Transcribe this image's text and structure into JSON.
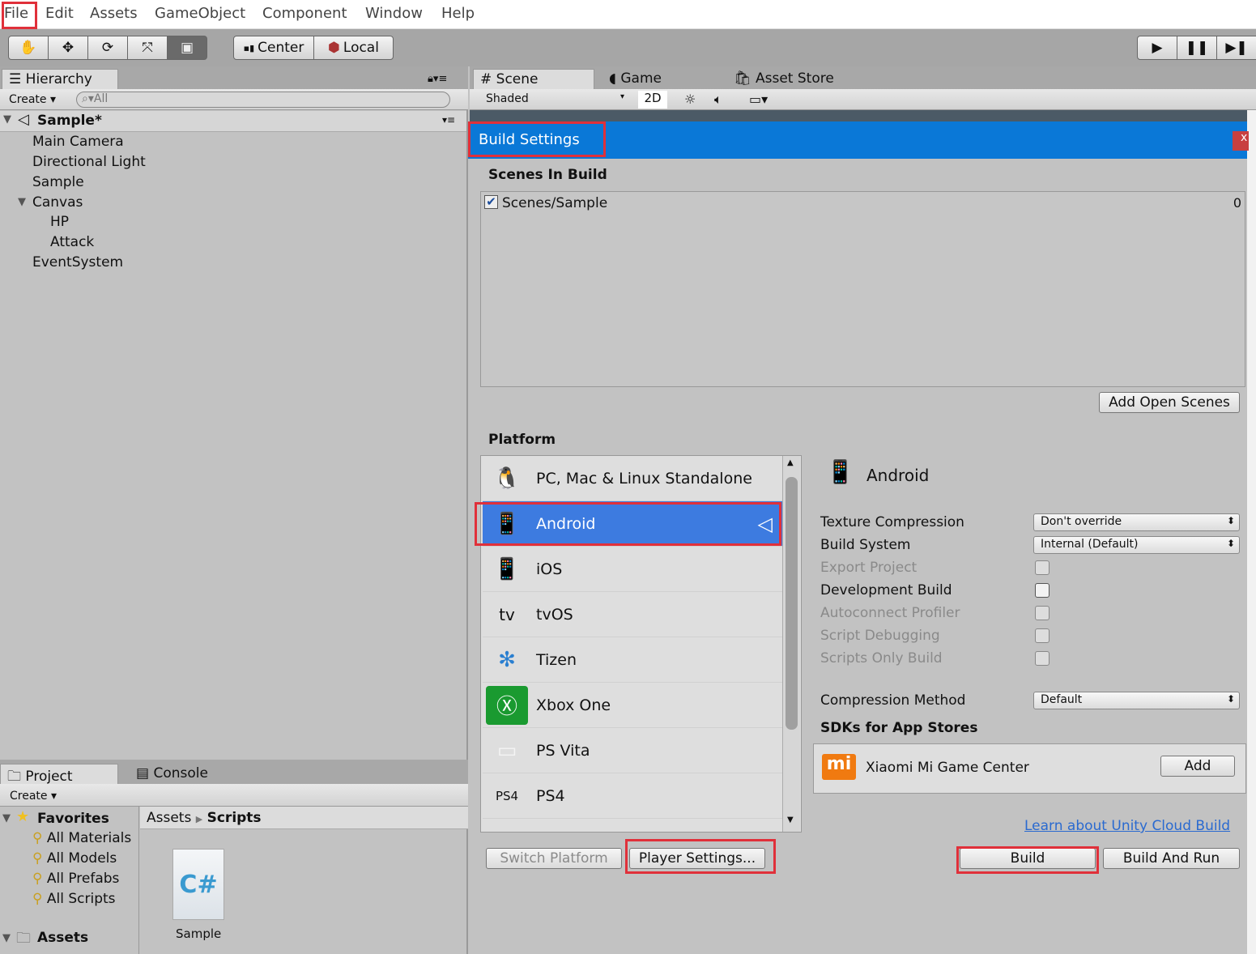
{
  "menu": [
    "File",
    "Edit",
    "Assets",
    "GameObject",
    "Component",
    "Window",
    "Help"
  ],
  "toolbar": {
    "tools": [
      "hand-tool",
      "move-tool",
      "rotate-tool",
      "scale-tool",
      "rect-tool"
    ],
    "pivot": "Center",
    "space": "Local"
  },
  "hierarchy": {
    "tab": "Hierarchy",
    "create": "Create",
    "search_placeholder": "All",
    "scene": "Sample*",
    "items": [
      "Main Camera",
      "Directional Light",
      "Sample",
      "Canvas",
      "HP",
      "Attack",
      "EventSystem"
    ]
  },
  "scene_tabs": {
    "scene": "Scene",
    "game": "Game",
    "asset_store": "Asset Store",
    "shading": "Shaded",
    "mode2d": "2D"
  },
  "project": {
    "tab": "Project",
    "console": "Console",
    "create": "Create",
    "favorites": "Favorites",
    "fav_items": [
      "All Materials",
      "All Models",
      "All Prefabs",
      "All Scripts"
    ],
    "assets": "Assets",
    "breadcrumb": [
      "Assets",
      "Scripts"
    ],
    "file": "Sample",
    "file_icon": "C#"
  },
  "build": {
    "title": "Build Settings",
    "close": "x",
    "scenes_header": "Scenes In Build",
    "scene_entry": "Scenes/Sample",
    "scene_index": "0",
    "add_open_scenes": "Add Open Scenes",
    "platform_header": "Platform",
    "platforms": [
      "PC, Mac & Linux Standalone",
      "Android",
      "iOS",
      "tvOS",
      "Tizen",
      "Xbox One",
      "PS Vita",
      "PS4"
    ],
    "selected_platform": "Android",
    "settings": {
      "texture_compression": "Texture Compression",
      "texture_compression_value": "Don't override",
      "build_system": "Build System",
      "build_system_value": "Internal (Default)",
      "export_project": "Export Project",
      "development_build": "Development Build",
      "autoconnect_profiler": "Autoconnect Profiler",
      "script_debugging": "Script Debugging",
      "scripts_only_build": "Scripts Only Build",
      "compression_method": "Compression Method",
      "compression_method_value": "Default"
    },
    "sdks_header": "SDKs for App Stores",
    "sdk_name": "Xiaomi Mi Game Center",
    "sdk_add": "Add",
    "cloud_link": "Learn about Unity Cloud Build",
    "switch_platform": "Switch Platform",
    "player_settings": "Player Settings...",
    "build": "Build",
    "build_and_run": "Build And Run"
  },
  "colors": {
    "accent": "#0a78d7",
    "highlight": "#e0303a",
    "selected": "#3d7be0"
  }
}
